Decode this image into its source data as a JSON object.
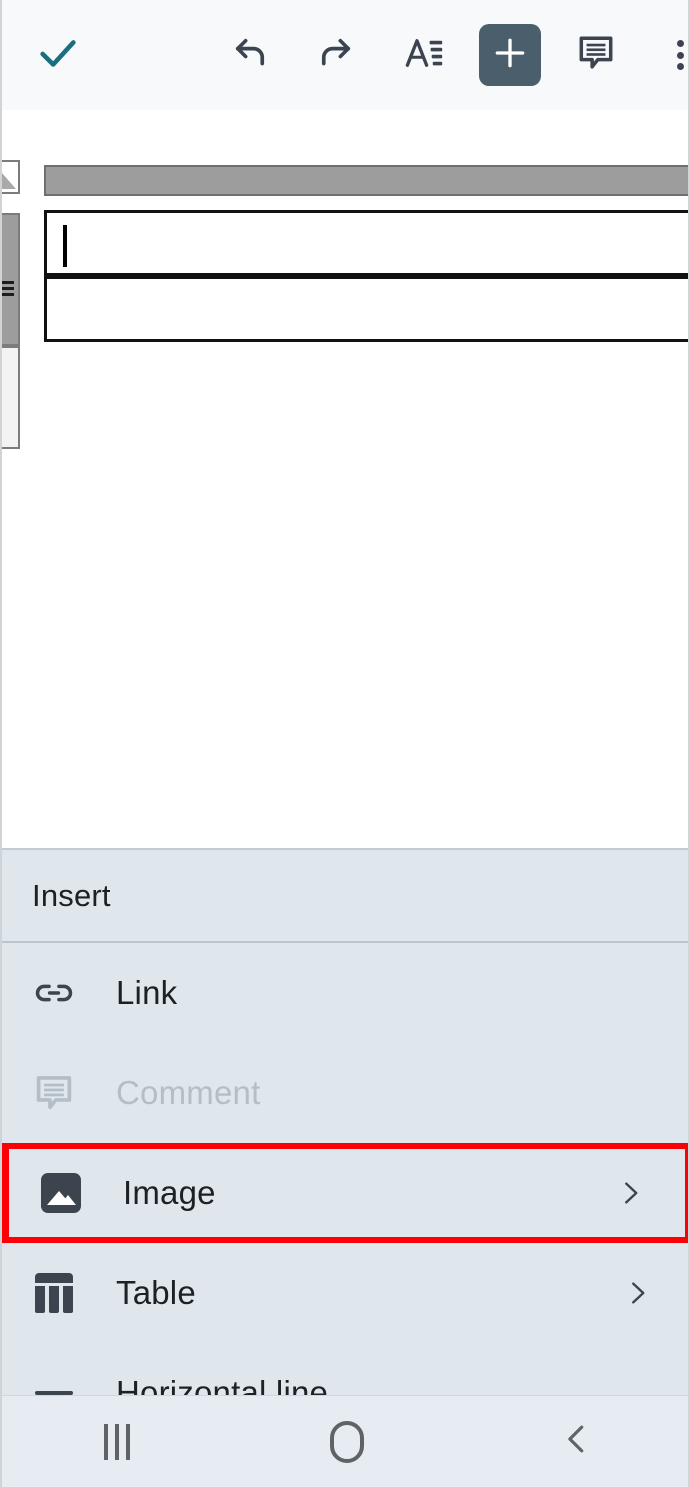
{
  "app": {
    "platform": "android",
    "screen_title": "Document editor with Insert menu open"
  },
  "toolbar": {
    "done_label": "Done",
    "done_icon": "check-icon",
    "done_color": "#1b6d80",
    "undo_label": "Undo",
    "undo_icon": "undo-arrow-icon",
    "redo_label": "Redo",
    "redo_icon": "redo-arrow-icon",
    "format_label": "Text formatting",
    "format_icon": "text-format-icon",
    "insert_label": "Insert",
    "insert_icon": "plus-icon",
    "insert_active": true,
    "insert_active_bg": "#4b5e6b",
    "comment_label": "Comment",
    "comment_icon": "comment-icon",
    "more_label": "More options",
    "more_icon": "more-vertical-icon",
    "icon_color": "#3c4450",
    "background": "#f8f9fb"
  },
  "document": {
    "column_bar_label": "",
    "column_bar_color": "#9d9d9d",
    "corner_handle_label": "Select all",
    "row_handle_label": "Row handle",
    "cells": [
      {
        "text": "",
        "has_caret": true
      },
      {
        "text": "",
        "has_caret": false
      }
    ],
    "background": "#ffffff"
  },
  "insert_panel": {
    "title": "Insert",
    "background": "#dfe7ed",
    "highlight_color": "#fb0007",
    "items": [
      {
        "label": "Link",
        "icon": "link-icon",
        "disabled": false,
        "has_submenu": false,
        "highlighted": false
      },
      {
        "label": "Comment",
        "icon": "comment-icon",
        "disabled": true,
        "has_submenu": false,
        "highlighted": false
      },
      {
        "label": "Image",
        "icon": "image-icon",
        "disabled": false,
        "has_submenu": true,
        "highlighted": true
      },
      {
        "label": "Table",
        "icon": "table-icon",
        "disabled": false,
        "has_submenu": true,
        "highlighted": false
      },
      {
        "label": "Horizontal line",
        "icon": "horizontal-line-icon",
        "disabled": false,
        "has_submenu": false,
        "highlighted": false
      }
    ]
  },
  "navbar": {
    "recents_label": "Recent apps",
    "recents_icon": "recents-icon",
    "home_label": "Home",
    "home_icon": "home-icon",
    "back_label": "Back",
    "back_icon": "back-chevron-icon",
    "icon_color": "#5f6368",
    "background": "#e6ecf2"
  }
}
